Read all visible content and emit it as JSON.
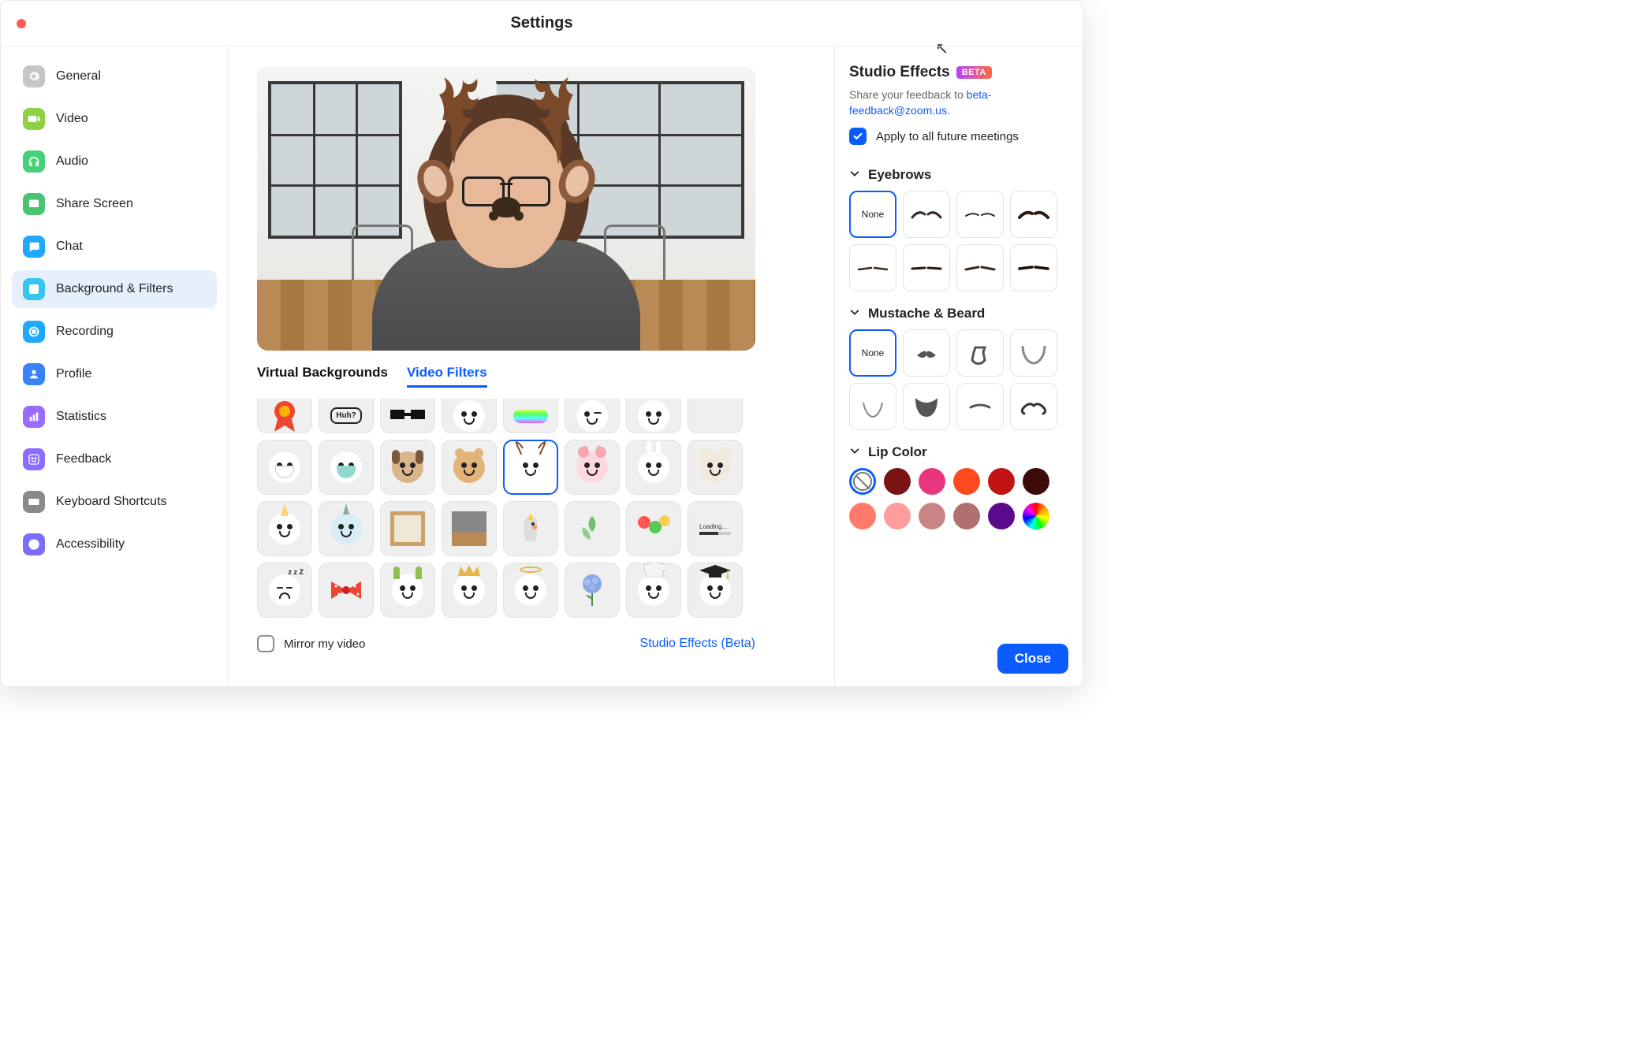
{
  "window_title": "Settings",
  "sidebar": {
    "items": [
      {
        "id": "general",
        "label": "General",
        "icon": "gear",
        "color": "#c6c6c6"
      },
      {
        "id": "video",
        "label": "Video",
        "icon": "video",
        "color": "#8fd143"
      },
      {
        "id": "audio",
        "label": "Audio",
        "icon": "headphones",
        "color": "#46d07a"
      },
      {
        "id": "share",
        "label": "Share Screen",
        "icon": "share",
        "color": "#4ac471"
      },
      {
        "id": "chat",
        "label": "Chat",
        "icon": "chat",
        "color": "#1fa8ff"
      },
      {
        "id": "bgfilters",
        "label": "Background & Filters",
        "icon": "person",
        "color": "#36c5f0",
        "selected": true
      },
      {
        "id": "recording",
        "label": "Recording",
        "icon": "record",
        "color": "#1fa8ff"
      },
      {
        "id": "profile",
        "label": "Profile",
        "icon": "profile",
        "color": "#3b82f6"
      },
      {
        "id": "stats",
        "label": "Statistics",
        "icon": "stats",
        "color": "#9b6dff"
      },
      {
        "id": "feedback",
        "label": "Feedback",
        "icon": "smile",
        "color": "#8a6dff"
      },
      {
        "id": "shortcuts",
        "label": "Keyboard Shortcuts",
        "icon": "keyboard",
        "color": "#8a8a8a"
      },
      {
        "id": "accessibility",
        "label": "Accessibility",
        "icon": "accessibility",
        "color": "#7a6dff"
      }
    ]
  },
  "main": {
    "tabs": [
      {
        "id": "vb",
        "label": "Virtual Backgrounds",
        "active": false
      },
      {
        "id": "vf",
        "label": "Video Filters",
        "active": true
      }
    ],
    "filters": [
      {
        "kind": "ribbon"
      },
      {
        "kind": "huh",
        "text": "Huh?"
      },
      {
        "kind": "pixel-glasses"
      },
      {
        "kind": "cute-face"
      },
      {
        "kind": "rainbow-band"
      },
      {
        "kind": "wink"
      },
      {
        "kind": "big-smile"
      },
      {
        "kind": "blank"
      },
      {
        "kind": "mask1"
      },
      {
        "kind": "mask2"
      },
      {
        "kind": "dog"
      },
      {
        "kind": "bear"
      },
      {
        "kind": "deer",
        "selected": true
      },
      {
        "kind": "pig"
      },
      {
        "kind": "bunny"
      },
      {
        "kind": "mouse"
      },
      {
        "kind": "unicorn"
      },
      {
        "kind": "narwhal"
      },
      {
        "kind": "frame-wood"
      },
      {
        "kind": "frame-room"
      },
      {
        "kind": "cockatiel"
      },
      {
        "kind": "leaves"
      },
      {
        "kind": "lollipops"
      },
      {
        "kind": "loading",
        "text": "Loading..."
      },
      {
        "kind": "sleep"
      },
      {
        "kind": "bow"
      },
      {
        "kind": "shrek-ears"
      },
      {
        "kind": "crown"
      },
      {
        "kind": "halo"
      },
      {
        "kind": "hydrangea"
      },
      {
        "kind": "chef-hat"
      },
      {
        "kind": "grad-cap"
      }
    ],
    "mirror_label": "Mirror my video",
    "mirror_checked": false,
    "studio_link": "Studio Effects (Beta)"
  },
  "right": {
    "title": "Studio Effects",
    "badge": "BETA",
    "feedback_pre": "Share your feedback to ",
    "feedback_link": "beta-feedback@zoom.us",
    "feedback_post": ".",
    "apply_label": "Apply to all future meetings",
    "apply_checked": true,
    "sections": {
      "eyebrows": {
        "label": "Eyebrows",
        "none": "None",
        "options": [
          "none",
          "brow-arc",
          "brow-thin",
          "brow-thick",
          "brow-flat1",
          "brow-flat2",
          "brow-flat3",
          "brow-flat4"
        ]
      },
      "beard": {
        "label": "Mustache & Beard",
        "none": "None",
        "options": [
          "none",
          "mustache",
          "goatee",
          "chin-outline",
          "chin-line",
          "full-beard",
          "thin-stache",
          "handlebar"
        ]
      },
      "lip": {
        "label": "Lip Color",
        "colors": [
          "none",
          "#7a1414",
          "#e8357e",
          "#ff4a1f",
          "#c31414",
          "#3d0a0a",
          "#ff7a6a",
          "#ff9c9c",
          "#c98585",
          "#b07070",
          "#5a0a8a",
          "rainbow"
        ]
      }
    },
    "close": "Close"
  }
}
